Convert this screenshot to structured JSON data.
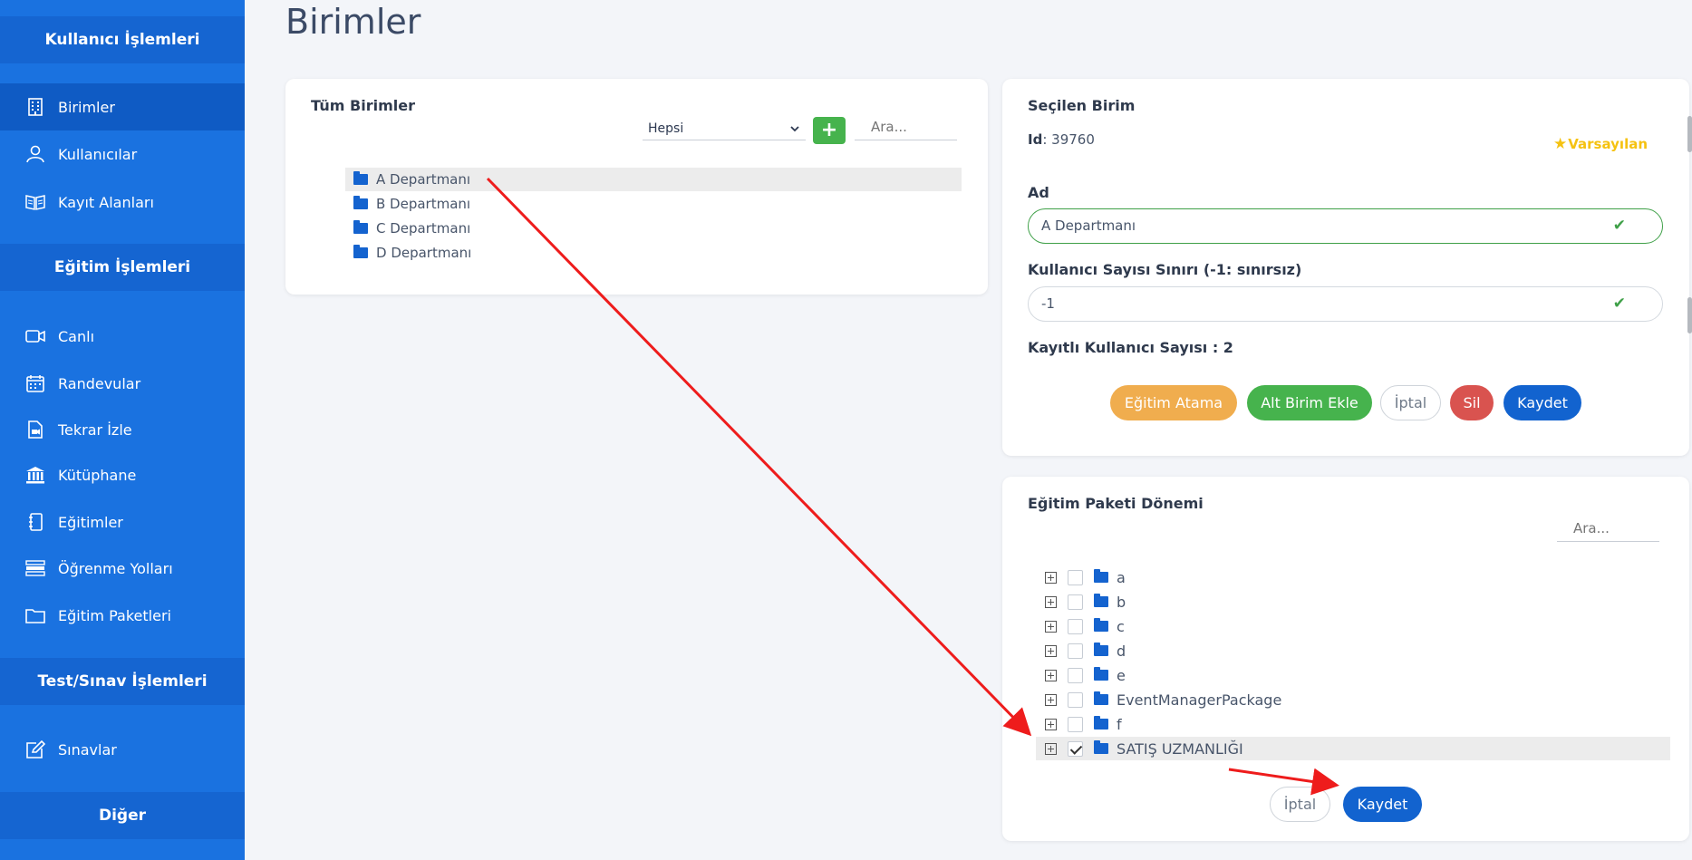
{
  "sidebar": {
    "sections": [
      "Kullanıcı İşlemleri",
      "Eğitim İşlemleri",
      "Test/Sınav İşlemleri",
      "Diğer"
    ],
    "items": [
      {
        "label": "Birimler",
        "icon": "building-icon",
        "active": true
      },
      {
        "label": "Kullanıcılar",
        "icon": "users-icon"
      },
      {
        "label": "Kayıt Alanları",
        "icon": "book-open-icon"
      },
      {
        "label": "Canlı",
        "icon": "video-icon"
      },
      {
        "label": "Randevular",
        "icon": "calendar-icon"
      },
      {
        "label": "Tekrar İzle",
        "icon": "file-video-icon"
      },
      {
        "label": "Kütüphane",
        "icon": "library-icon"
      },
      {
        "label": "Eğitimler",
        "icon": "notebook-icon"
      },
      {
        "label": "Öğrenme Yolları",
        "icon": "road-icon"
      },
      {
        "label": "Eğitim Paketleri",
        "icon": "folder-icon"
      },
      {
        "label": "Sınavlar",
        "icon": "edit-icon"
      }
    ]
  },
  "page": {
    "title": "Birimler"
  },
  "units_panel": {
    "title": "Tüm Birimler",
    "filter_value": "Hepsi",
    "search_placeholder": "Ara...",
    "add_label": "+",
    "units": [
      "A Departmanı",
      "B Departmanı",
      "C Departmanı",
      "D Departmanı"
    ],
    "selected_index": 0
  },
  "selected_unit": {
    "title": "Seçilen Birim",
    "id_label": "Id",
    "id_value": ": 39760",
    "default_badge": "Varsayılan",
    "name_label": "Ad",
    "name_value": "A Departmanı",
    "limit_label": "Kullanıcı Sayısı Sınırı (-1: sınırsız)",
    "limit_value": "-1",
    "registered_label": "Kayıtlı Kullanıcı Sayısı : 2",
    "buttons": {
      "assign": "Eğitim Atama",
      "add_sub": "Alt Birim Ekle",
      "cancel": "İptal",
      "delete": "Sil",
      "save": "Kaydet"
    },
    "colors": {
      "assign": "#f0ad4e",
      "add_sub": "#46b34d",
      "delete": "#d9534f",
      "save": "#1263cf"
    }
  },
  "package_panel": {
    "title": "Eğitim Paketi Dönemi",
    "search_placeholder": "Ara...",
    "packages": [
      {
        "label": "a",
        "checked": false
      },
      {
        "label": "b",
        "checked": false
      },
      {
        "label": "c",
        "checked": false
      },
      {
        "label": "d",
        "checked": false
      },
      {
        "label": "e",
        "checked": false
      },
      {
        "label": "EventManagerPackage",
        "checked": false
      },
      {
        "label": "f",
        "checked": false
      },
      {
        "label": "SATIŞ UZMANLIĞI",
        "checked": true
      }
    ],
    "cancel_label": "İptal",
    "save_label": "Kaydet"
  }
}
